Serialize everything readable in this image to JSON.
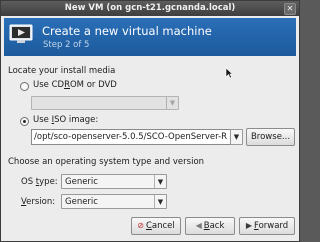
{
  "window": {
    "title": "New VM (on gcn-t21.gcnanda.local)"
  },
  "header": {
    "title": "Create a new virtual machine",
    "step": "Step 2 of 5"
  },
  "install_media": {
    "section_label": "Locate your install media",
    "cdrom": {
      "label_prefix": "Use CD",
      "label_mnemonic": "R",
      "label_suffix": "OM or DVD",
      "selected": false,
      "dropdown_value": ""
    },
    "iso": {
      "label_prefix": "Use ",
      "label_mnemonic": "I",
      "label_suffix": "SO image:",
      "selected": true,
      "path": "/opt/sco-openserver-5.0.5/SCO-OpenServer-R",
      "browse_label": "Browse..."
    }
  },
  "os": {
    "section_label": "Choose an operating system type and version",
    "type": {
      "label_prefix": "OS ",
      "label_mnemonic": "t",
      "label_suffix": "ype:",
      "value": "Generic"
    },
    "version": {
      "label_prefix": "",
      "label_mnemonic": "V",
      "label_suffix": "ersion:",
      "value": "Generic"
    }
  },
  "buttons": {
    "cancel": {
      "mnemonic": "C",
      "rest": "ancel"
    },
    "back": {
      "mnemonic": "B",
      "rest": "ack"
    },
    "forward": {
      "mnemonic": "F",
      "rest": "orward"
    }
  },
  "colors": {
    "header_bg": "#2a6fb8",
    "titlebar_bg": "#4a4a4a"
  }
}
